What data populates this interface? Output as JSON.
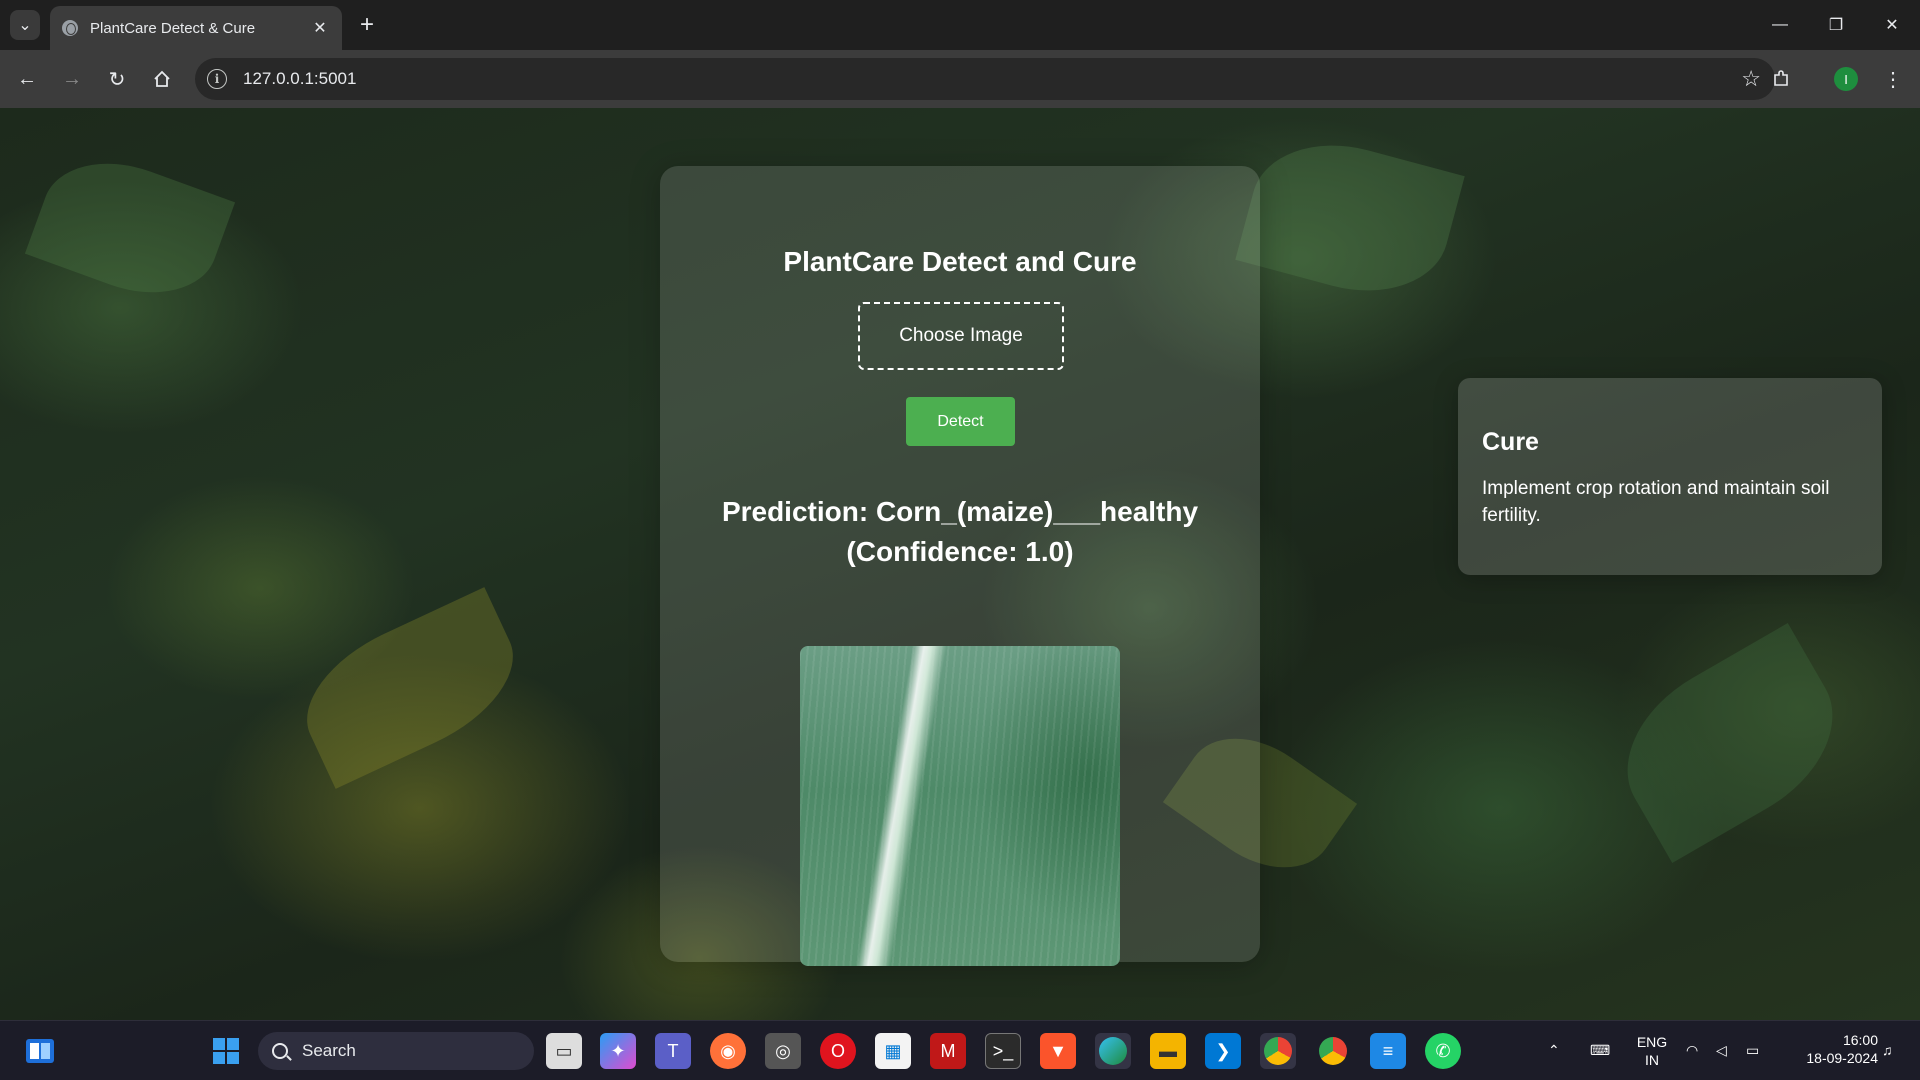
{
  "browser": {
    "tab_title": "PlantCare Detect & Cure",
    "tab_close": "✕",
    "new_tab": "+",
    "url": "127.0.0.1:5001",
    "profile_initial": "I",
    "window": {
      "minimize": "—",
      "restore": "❐",
      "close": "✕"
    }
  },
  "page": {
    "title": "PlantCare Detect and Cure",
    "choose_label": "Choose Image",
    "detect_label": "Detect",
    "prediction_line1": "Prediction: Corn_(maize)___healthy",
    "prediction_line2": "(Confidence: 1.0)",
    "cure": {
      "title": "Cure",
      "text": "Implement crop rotation and maintain soil fertility."
    }
  },
  "taskbar": {
    "search_label": "Search",
    "lang_line1": "ENG",
    "lang_line2": "IN",
    "time": "16:00",
    "date": "18-09-2024",
    "apps": [
      "file-explorer-icon",
      "copilot-icon",
      "teams-icon",
      "firefox-icon",
      "camera-icon",
      "opera-icon",
      "store-icon",
      "mcafee-icon",
      "terminal-icon",
      "brave-icon",
      "edge-icon",
      "folder-icon",
      "vscode-icon",
      "chrome-icon",
      "chrome-canary-icon",
      "notepad-icon",
      "whatsapp-icon"
    ]
  },
  "colors": {
    "detect_button": "#4caf50",
    "chrome_dark": "#1f1f1f",
    "toolbar": "#3c3c3c"
  }
}
